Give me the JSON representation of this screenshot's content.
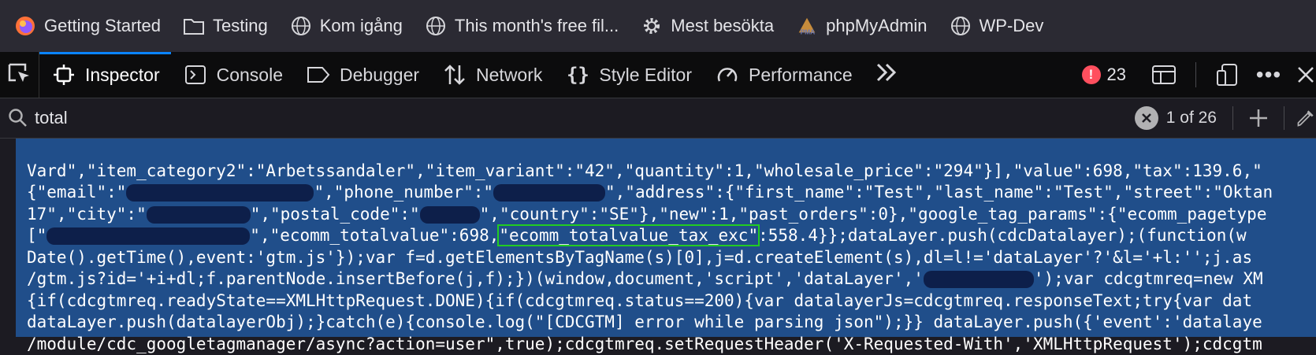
{
  "bookmarks": [
    {
      "label": "Getting Started",
      "icon": "firefox-icon"
    },
    {
      "label": "Testing",
      "icon": "folder-icon"
    },
    {
      "label": "Kom igång",
      "icon": "globe-icon"
    },
    {
      "label": "This month's free fil...",
      "icon": "globe-icon"
    },
    {
      "label": "Mest besökta",
      "icon": "gear-icon"
    },
    {
      "label": "phpMyAdmin",
      "icon": "phpmyadmin-icon"
    },
    {
      "label": "WP-Dev",
      "icon": "globe-icon"
    }
  ],
  "devtools": {
    "tabs": [
      {
        "label": "Inspector",
        "icon": "inspector-icon",
        "active": true
      },
      {
        "label": "Console",
        "icon": "console-icon"
      },
      {
        "label": "Debugger",
        "icon": "debugger-icon"
      },
      {
        "label": "Network",
        "icon": "network-icon"
      },
      {
        "label": "Style Editor",
        "icon": "braces-icon"
      },
      {
        "label": "Performance",
        "icon": "gauge-icon"
      }
    ],
    "error_count": "23",
    "accent": "#0a84ff",
    "error_color": "#ff4f5e"
  },
  "search": {
    "value": "total",
    "result_count": "1 of 26"
  },
  "code": {
    "highlight_color": "#22cc22",
    "selection_color": "#204e8a",
    "lines": [
      {
        "a": "Vard\",\"item_category2\":\"Arbetssandaler\",\"item_variant\":\"42\",\"quantity\":1,\"wholesale_price\":\"294\"}],\"value\":698,\"tax\":139.6,\""
      },
      {
        "a": "{\"email\":\"",
        "b": "\",\"phone_number\":\"",
        "c": "\",\"address\":{\"first_name\":\"Test\",\"last_name\":\"Test\",\"street\":\"Oktan"
      },
      {
        "a": "17\",\"city\":\"",
        "b": "\",\"postal_code\":\"",
        "c": "\",\"country\":\"SE\"},\"new\":1,\"past_orders\":0},\"google_tag_params\":{\"ecomm_pagetype"
      },
      {
        "a": "[\"",
        "b": "\",\"ecomm_totalvalue\":698,",
        "hl": "\"ecomm_totalvalue_tax_exc\"",
        "c": ":558.4}};dataLayer.push(cdcDatalayer);(function(w"
      },
      {
        "a": "Date().getTime(),event:'gtm.js'});var f=d.getElementsByTagName(s)[0],j=d.createElement(s),dl=l!='dataLayer'?'&l='+l:'';j.as"
      },
      {
        "a": "/gtm.js?id='+i+dl;f.parentNode.insertBefore(j,f);})(window,document,'script','dataLayer','",
        "b": "');var cdcgtmreq=new XM"
      },
      {
        "a": "{if(cdcgtmreq.readyState==XMLHttpRequest.DONE){if(cdcgtmreq.status==200){var datalayerJs=cdcgtmreq.responseText;try{var dat"
      },
      {
        "a": "dataLayer.push(datalayerObj);}catch(e){console.log(\"[CDCGTM] error while parsing json\");}} dataLayer.push({'event':'datalaye"
      },
      {
        "a": "/module/cdc_googletagmanager/async?action=user\",true);cdcgtmreq.setRequestHeader('X-Requested-With','XMLHttpRequest');cdcgtm"
      }
    ]
  }
}
